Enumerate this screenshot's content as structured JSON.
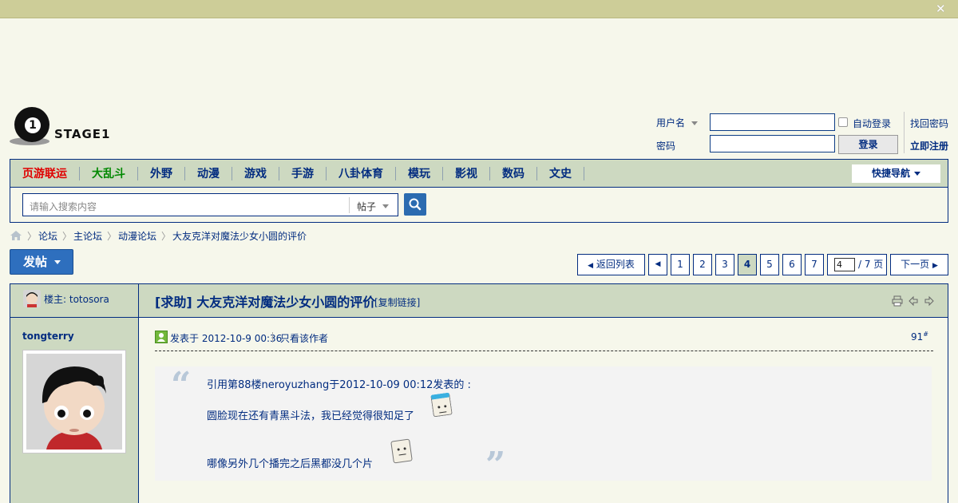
{
  "site": {
    "logo_text": "STAGE1",
    "logo_mark": "1"
  },
  "login": {
    "username_label": "用户名",
    "password_label": "密码",
    "auto_login_label": "自动登录",
    "login_button": "登录",
    "find_password": "找回密码",
    "register": "立即注册"
  },
  "nav": {
    "items": [
      "页游联运",
      "大乱斗",
      "外野",
      "动漫",
      "游戏",
      "手游",
      "八卦体育",
      "模玩",
      "影视",
      "数码",
      "文史"
    ],
    "quick_nav": "快捷导航"
  },
  "search": {
    "placeholder": "请输入搜索内容",
    "type": "帖子"
  },
  "breadcrumb": [
    "论坛",
    "主论坛",
    "动漫论坛",
    "大友克洋对魔法少女小圆的评价"
  ],
  "post_button": "发帖",
  "pager": {
    "back": "返回列表",
    "pages": [
      "1",
      "2",
      "3",
      "4",
      "5",
      "6",
      "7"
    ],
    "current": "4",
    "jump_value": "4",
    "total": "/ 7 页",
    "next": "下一页"
  },
  "thread": {
    "owner": "楼主: totosora",
    "title": "[求助] 大友克洋对魔法少女小圆的评价",
    "copy_link": "[复制链接]"
  },
  "post": {
    "author": "tongterry",
    "posted": "发表于 2012-10-9 00:36",
    "only_author": "只看该作者",
    "floor": "91",
    "floor_mark": "#",
    "quote_header": "引用第88楼neroyuzhang于2012-10-09 00:12发表的 :",
    "quote_line1": "圆脸现在还有青黑斗法，我已经觉得很知足了",
    "quote_line2": "哪像另外几个播完之后黑都没几个片"
  },
  "colors": {
    "accent": "#022c80",
    "nav_bg": "#cdd9c1",
    "topbar": "#cdcd98",
    "button_blue": "#2e6fbe"
  },
  "icons": [
    "close-icon",
    "home-icon",
    "search-icon",
    "print-icon",
    "prev-icon",
    "next-icon",
    "online-icon",
    "emoticon-icon"
  ]
}
